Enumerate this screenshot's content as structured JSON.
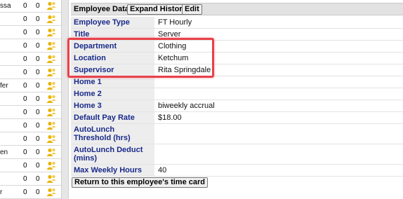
{
  "colors": {
    "label_text": "#1a2a8a",
    "label_bg": "#ededed",
    "header_bg": "#e2e2e2",
    "highlight": "#e8414a",
    "person_icon": "#e8b400"
  },
  "left_list": {
    "rows": [
      {
        "name": "ssa",
        "c1": "0",
        "c2": "0",
        "icon": "person-icon"
      },
      {
        "name": "",
        "c1": "0",
        "c2": "0",
        "icon": "person-icon"
      },
      {
        "name": "",
        "c1": "0",
        "c2": "0",
        "icon": "person-icon"
      },
      {
        "name": "",
        "c1": "0",
        "c2": "0",
        "icon": "person-icon"
      },
      {
        "name": "",
        "c1": "0",
        "c2": "0",
        "icon": "person-icon"
      },
      {
        "name": "",
        "c1": "0",
        "c2": "0",
        "icon": "person-icon"
      },
      {
        "name": "fer",
        "c1": "0",
        "c2": "0",
        "icon": "person-icon"
      },
      {
        "name": "",
        "c1": "0",
        "c2": "0",
        "icon": "person-icon"
      },
      {
        "name": "",
        "c1": "0",
        "c2": "0",
        "icon": "person-icon"
      },
      {
        "name": "",
        "c1": "0",
        "c2": "0",
        "icon": "person-icon"
      },
      {
        "name": "",
        "c1": "0",
        "c2": "0",
        "icon": "person-icon"
      },
      {
        "name": "en",
        "c1": "0",
        "c2": "0",
        "icon": "person-icon"
      },
      {
        "name": "",
        "c1": "0",
        "c2": "0",
        "icon": "person-icon"
      },
      {
        "name": "",
        "c1": "0",
        "c2": "0",
        "icon": "person-icon"
      },
      {
        "name": "r",
        "c1": "0",
        "c2": "0",
        "icon": "person-icon"
      }
    ]
  },
  "panel": {
    "title": "Employee Data",
    "expand_history_label": "Expand History",
    "edit_label": "Edit",
    "rows": [
      {
        "label": "Employee Type",
        "value": "FT Hourly"
      },
      {
        "label": "Title",
        "value": "Server"
      },
      {
        "label": "Department",
        "value": "Clothing"
      },
      {
        "label": "Location",
        "value": "Ketchum"
      },
      {
        "label": "Supervisor",
        "value": "Rita Springdale"
      },
      {
        "label": "Home 1",
        "value": ""
      },
      {
        "label": "Home 2",
        "value": ""
      },
      {
        "label": "Home 3",
        "value": "biweekly accrual"
      },
      {
        "label": "Default Pay Rate",
        "value": "$18.00"
      },
      {
        "label": "AutoLunch Threshold (hrs)",
        "value": ""
      },
      {
        "label": "AutoLunch Deduct (mins)",
        "value": ""
      },
      {
        "label": "Max Weekly Hours",
        "value": "40"
      }
    ],
    "return_label": "Return to this employee's time card"
  }
}
